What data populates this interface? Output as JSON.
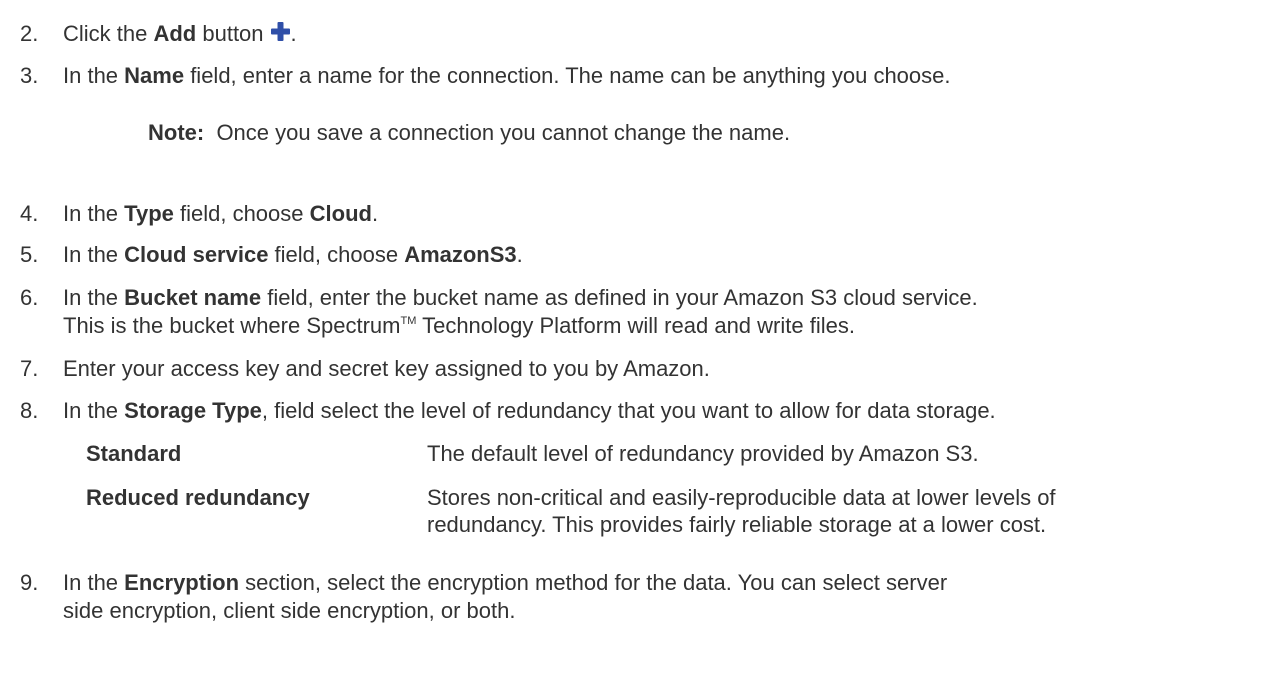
{
  "steps": [
    {
      "num": "2.",
      "pre": "Click the ",
      "bold": "Add",
      "post": " button",
      "icon": "plus-icon",
      "tail": "."
    },
    {
      "num": "3.",
      "pre": "In the ",
      "bold": "Name",
      "post": " field, enter a name for the connection. The name can be anything you choose."
    },
    {
      "num": "4.",
      "pre": "In the ",
      "bold": "Type",
      "post": " field, choose ",
      "bold2": "Cloud",
      "tail": "."
    },
    {
      "num": "5.",
      "pre": "In the ",
      "bold": "Cloud service",
      "post": " field, choose ",
      "bold2": "AmazonS3",
      "tail": "."
    },
    {
      "num": "6.",
      "pre": "In the ",
      "bold": "Bucket name",
      "post": " field, enter the bucket name as defined in your Amazon S3 cloud service.",
      "line2_pre": "This is the bucket where Spectrum",
      "line2_sup": "TM",
      "line2_post": " Technology Platform will read and write files."
    },
    {
      "num": "7.",
      "text": "Enter your access key and secret key assigned to you by Amazon."
    },
    {
      "num": "8.",
      "pre": "In the ",
      "bold": "Storage Type",
      "post": ", field select the level of redundancy that you want to allow for data storage."
    },
    {
      "num": "9.",
      "pre": "In the ",
      "bold": "Encryption",
      "post": " section, select the encryption method for the data. You can select server",
      "line2": "side encryption, client side encryption, or both."
    }
  ],
  "note": {
    "label": "Note:",
    "text": "  Once you save a connection you cannot change the name."
  },
  "storage_types": [
    {
      "term": "Standard",
      "def": "The default level of redundancy provided by Amazon S3."
    },
    {
      "term": "Reduced redundancy",
      "def": "Stores non-critical and easily-reproducible data at lower levels of",
      "def2": "redundancy. This provides fairly reliable storage at a lower cost."
    }
  ],
  "colors": {
    "text": "#333333",
    "plus_icon": "#2f4fa8"
  }
}
